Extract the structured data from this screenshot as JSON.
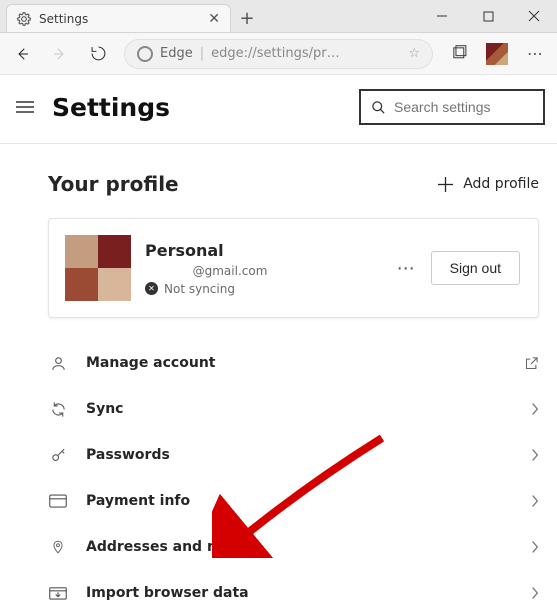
{
  "window": {
    "tab_title": "Settings",
    "new_tab_glyph": "+"
  },
  "toolbar": {
    "url_brand": "Edge",
    "url_text": "edge://settings/pr…"
  },
  "header": {
    "title": "Settings",
    "search_placeholder": "Search settings"
  },
  "profile_section": {
    "title": "Your profile",
    "add_label": "Add profile"
  },
  "profile_card": {
    "name": "Personal",
    "email": "@gmail.com",
    "sync_status": "Not syncing",
    "signout_label": "Sign out"
  },
  "items": [
    {
      "label": "Manage account",
      "icon": "person",
      "action": "external"
    },
    {
      "label": "Sync",
      "icon": "sync",
      "action": "chevron"
    },
    {
      "label": "Passwords",
      "icon": "key",
      "action": "chevron"
    },
    {
      "label": "Payment info",
      "icon": "card",
      "action": "chevron"
    },
    {
      "label": "Addresses and more",
      "icon": "pin",
      "action": "chevron"
    },
    {
      "label": "Import browser data",
      "icon": "import",
      "action": "chevron"
    }
  ]
}
